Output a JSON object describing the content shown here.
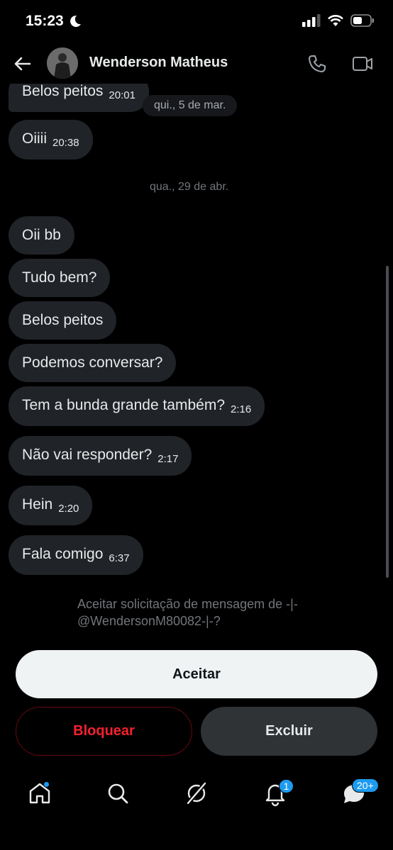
{
  "status": {
    "time": "15:23"
  },
  "header": {
    "name": "Wenderson Matheus"
  },
  "thread": {
    "date_pill": "qui., 5 de mar.",
    "date_separator": "qua., 29 de abr.",
    "messages": [
      {
        "text": "Belos peitos",
        "time": "20:01"
      },
      {
        "text": "Oiiii",
        "time": "20:38"
      },
      {
        "text": "Oii bb",
        "time": ""
      },
      {
        "text": "Tudo bem?",
        "time": ""
      },
      {
        "text": "Belos peitos",
        "time": ""
      },
      {
        "text": "Podemos conversar?",
        "time": ""
      },
      {
        "text": "Tem a bunda grande também?",
        "time": "2:16"
      },
      {
        "text": "Não vai responder?",
        "time": "2:17"
      },
      {
        "text": "Hein",
        "time": "2:20"
      },
      {
        "text": "Fala comigo",
        "time": "6:37"
      }
    ]
  },
  "request": {
    "line1": "Aceitar solicitação de mensagem de -|-",
    "line2": "@WendersonM80082-|-?"
  },
  "actions": {
    "accept": "Aceitar",
    "block": "Bloquear",
    "delete": "Excluir"
  },
  "nav": {
    "items": [
      "home-icon",
      "search-icon",
      "grok-icon",
      "notifications-icon",
      "messages-icon"
    ],
    "notifications_badge": "1",
    "messages_badge": "20+"
  },
  "colors": {
    "accent": "#1d9bf0",
    "danger": "#f4212e",
    "bubble": "#202327",
    "background": "#000000"
  }
}
